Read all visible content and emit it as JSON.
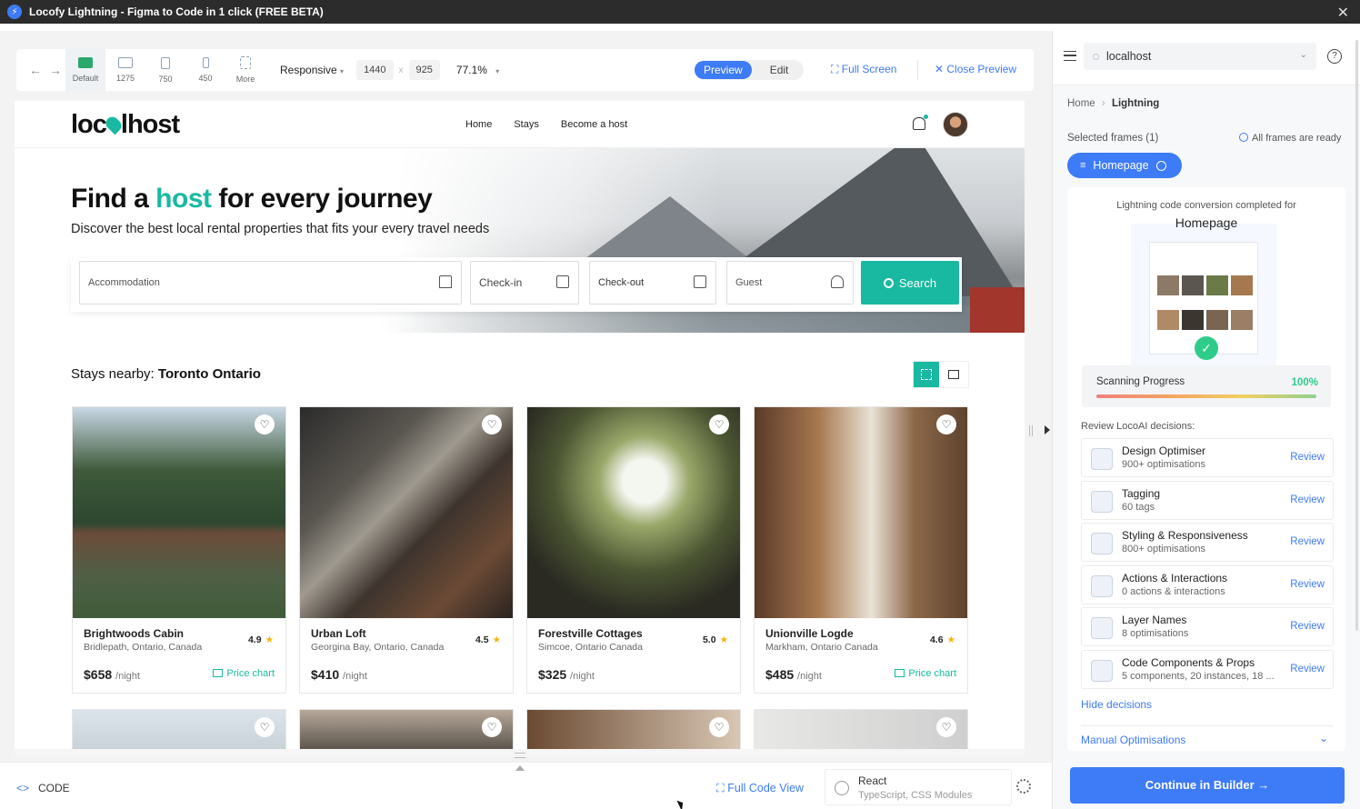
{
  "window": {
    "title": "Locofy Lightning - Figma to Code in 1 click (FREE BETA)",
    "close": "✕"
  },
  "toolbar": {
    "back": "←",
    "forward": "→",
    "devices": [
      {
        "label": "Default"
      },
      {
        "label": "1275"
      },
      {
        "label": "750"
      },
      {
        "label": "450"
      },
      {
        "label": "More"
      }
    ],
    "responsive": "Responsive",
    "width": "1440",
    "height": "925",
    "dim_separator": "x",
    "zoom": "77.1%",
    "preview": "Preview",
    "edit": "Edit",
    "full_screen": "Full Screen",
    "close_preview": "Close Preview"
  },
  "site": {
    "brand_left": "loc",
    "brand_right": "lhost",
    "nav": [
      "Home",
      "Stays",
      "Become a host"
    ],
    "hero_title_pre": "Find a ",
    "hero_title_accent": "host",
    "hero_title_post": " for every journey",
    "hero_sub": "Discover the best local rental properties that fits your every travel needs",
    "search": {
      "accommodation": "Accommodation",
      "checkin": "Check-in",
      "checkout": "Check-out",
      "guest": "Guest",
      "button": "Search"
    },
    "nearby_label": "Stays nearby: ",
    "nearby_city": "Toronto Ontario",
    "per_night": "/night",
    "price_chart": "Price chart",
    "cards": [
      {
        "name": "Brightwoods Cabin",
        "location": "Bridlepath, Ontario, Canada",
        "rating": "4.9",
        "price": "$658",
        "price_chart": true
      },
      {
        "name": "Urban Loft",
        "location": "Georgina Bay, Ontario, Canada",
        "rating": "4.5",
        "price": "$410",
        "price_chart": false
      },
      {
        "name": "Forestville Cottages",
        "location": "Simcoe, Ontario Canada",
        "rating": "5.0",
        "price": "$325",
        "price_chart": false
      },
      {
        "name": "Unionville Logde",
        "location": "Markham, Ontario Canada",
        "rating": "4.6",
        "price": "$485",
        "price_chart": true
      }
    ]
  },
  "bottom": {
    "code": "CODE",
    "full_code_view": "Full Code View",
    "framework": "React",
    "framework_sub": "TypeScript, CSS Modules"
  },
  "panel": {
    "host": "localhost",
    "breadcrumb_home": "Home",
    "breadcrumb_sep": "›",
    "breadcrumb_current": "Lightning",
    "selected_frames": "Selected frames (1)",
    "all_ready": "All frames are ready",
    "frame_chip": "Homepage",
    "conversion_text": "Lightning code conversion completed for",
    "conversion_name": "Homepage",
    "scan_label": "Scanning Progress",
    "scan_percent": "100%",
    "scan_progress": 1.0,
    "review_label": "Review LocoAI decisions:",
    "review": "Review",
    "decisions": [
      {
        "title": "Design Optimiser",
        "sub": "900+ optimisations"
      },
      {
        "title": "Tagging",
        "sub": "60 tags"
      },
      {
        "title": "Styling & Responsiveness",
        "sub": "800+ optimisations"
      },
      {
        "title": "Actions & Interactions",
        "sub": "0 actions & interactions"
      },
      {
        "title": "Layer Names",
        "sub": "8 optimisations"
      },
      {
        "title": "Code Components & Props",
        "sub": "5 components, 20 instances, 18 ..."
      }
    ],
    "hide_decisions": "Hide decisions",
    "manual": "Manual Optimisations",
    "continue": "Continue in Builder →"
  },
  "colors": {
    "brand": "#18b9a0",
    "accent": "#3e7bf6",
    "success": "#2ecc8a"
  }
}
